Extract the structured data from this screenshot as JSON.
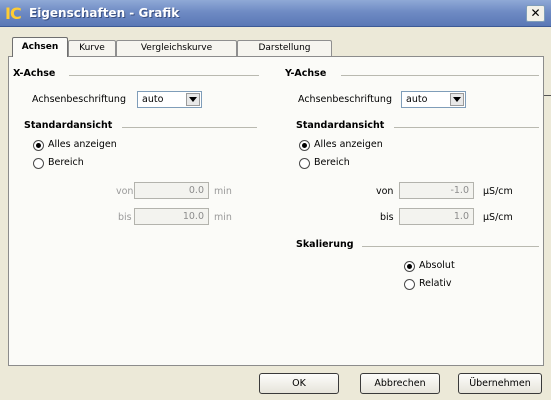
{
  "window": {
    "app_icon": "IC",
    "title": "Eigenschaften - Grafik",
    "close": "✕"
  },
  "tabs": [
    {
      "label": "Achsen",
      "active": true
    },
    {
      "label": "Kurve",
      "active": false
    },
    {
      "label": "Vergleichskurve",
      "active": false
    },
    {
      "label": "Darstellung",
      "active": false
    }
  ],
  "x_axis": {
    "title": "X-Achse",
    "label_caption": "Achsenbeschriftung",
    "label_value": "auto",
    "view_title": "Standardansicht",
    "option_all": "Alles anzeigen",
    "option_range": "Bereich",
    "selected": "all",
    "from_label": "von",
    "from_value": "0.0",
    "from_unit": "min",
    "to_label": "bis",
    "to_value": "10.0",
    "to_unit": "min"
  },
  "y_axis": {
    "title": "Y-Achse",
    "label_caption": "Achsenbeschriftung",
    "label_value": "auto",
    "view_title": "Standardansicht",
    "option_all": "Alles anzeigen",
    "option_range": "Bereich",
    "selected": "all",
    "from_label": "von",
    "from_value": "-1.0",
    "from_unit": "µS/cm",
    "to_label": "bis",
    "to_value": "1.0",
    "to_unit": "µS/cm",
    "scaling_title": "Skalierung",
    "scaling_absolute": "Absolut",
    "scaling_relative": "Relativ",
    "scaling_selected": "absolute"
  },
  "buttons": {
    "ok": "OK",
    "cancel": "Abbrechen",
    "apply": "Übernehmen"
  }
}
